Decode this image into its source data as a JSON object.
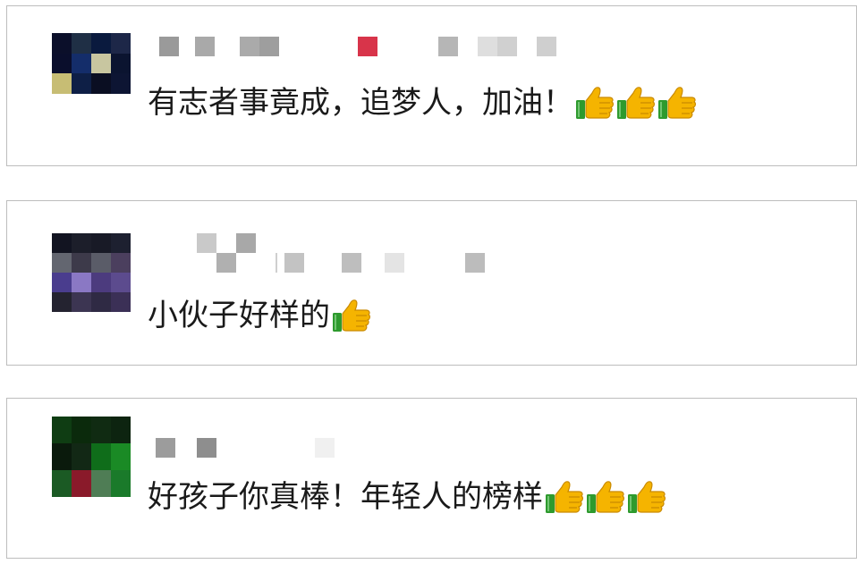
{
  "comments": [
    {
      "text": "有志者事竟成，追梦人，加油！",
      "thumbs_count": 3,
      "avatar": [
        "#0b0f2a",
        "#1f2f45",
        "#0a1a3e",
        "#1d2748",
        "#0a0e2c",
        "#142d6a",
        "#c8c6a0",
        "#0b1430",
        "#c7bd74",
        "#0e1f46",
        "#0a0e22",
        "#0d1533"
      ]
    },
    {
      "text": "小伙子好样的",
      "thumbs_count": 1,
      "avatar": [
        "#121421",
        "#1c1e2a",
        "#181a26",
        "#1d2030",
        "#636670",
        "#3d3a4a",
        "#5a5c68",
        "#4b3f5e",
        "#4a3d8e",
        "#8a78c4",
        "#4c3b7e",
        "#5c4b8e",
        "#242330",
        "#3c3552",
        "#2f2a44",
        "#3b3056"
      ]
    },
    {
      "text": "好孩子你真棒！年轻人的榜样",
      "thumbs_count": 3,
      "avatar": [
        "#0f3d13",
        "#0b2a0c",
        "#102b12",
        "#0d2410",
        "#0a1a0c",
        "#122815",
        "#0f6d1a",
        "#1a8a25",
        "#1b5a24",
        "#8a1a2a",
        "#4f7d55",
        "#1a7a2a",
        "#1c9a3a",
        "#18a048",
        "#1faacc",
        "#179c3a"
      ]
    }
  ],
  "colors": {
    "nick_gray": "#9a9a9a",
    "nick_red": "#d8344a",
    "thumb_yellow": "#f5b400",
    "thumb_green": "#2e9a2e"
  },
  "icons": {
    "thumb": "thumbs-up-icon"
  }
}
